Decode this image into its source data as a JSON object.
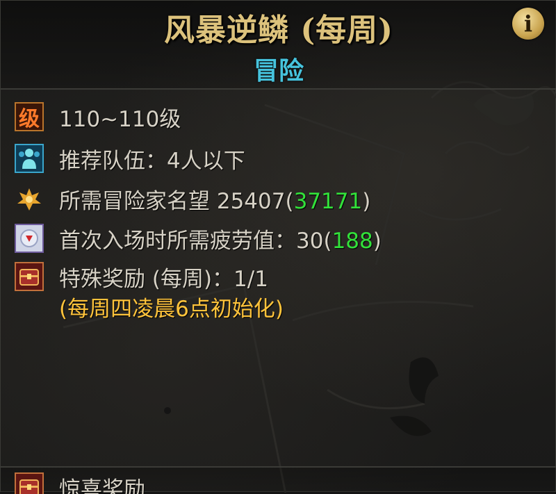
{
  "header": {
    "title": "风暴逆鳞 (每周)",
    "subtitle": "冒险",
    "info_icon": "info-icon",
    "info_label": "i"
  },
  "colors": {
    "title_gold": "#dcc27c",
    "subtitle_cyan": "#46c3dd",
    "text_default": "#d7d2c6",
    "value_green": "#32e13a",
    "note_yellow": "#ffc33b"
  },
  "rows": [
    {
      "icon": "level-icon",
      "icon_glyph": "级",
      "text": "110~110级"
    },
    {
      "icon": "team-icon",
      "text": "推荐队伍：4人以下"
    },
    {
      "icon": "fame-icon",
      "label": "所需冒险家名望",
      "value": " 25407",
      "paren_open": "(",
      "highlight": "37171",
      "paren_close": ")"
    },
    {
      "icon": "fatigue-icon",
      "label": "首次入场时所需疲劳值：30",
      "paren_open": "(",
      "highlight": "188",
      "paren_close": ")"
    },
    {
      "icon": "chest-icon",
      "text": "特殊奖励 (每周)：1/1"
    }
  ],
  "reward_note": "(每周四凌晨6点初始化)",
  "footer": {
    "icon": "chest-icon",
    "text": "惊喜奖励"
  }
}
